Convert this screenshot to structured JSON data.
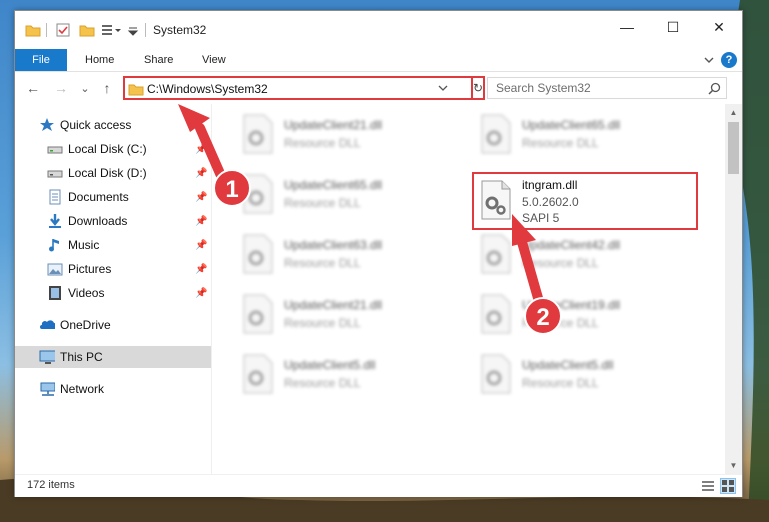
{
  "window": {
    "title": "System32",
    "controls": {
      "minimize": "—",
      "maximize": "☐",
      "close": "✕"
    }
  },
  "ribbon": {
    "tabs": [
      "File",
      "Home",
      "Share",
      "View"
    ],
    "help": "?"
  },
  "navigation": {
    "back": "←",
    "forward": "→",
    "recent": "⌄",
    "up": "↑",
    "address": "C:\\Windows\\System32",
    "refresh": "↻",
    "search_placeholder": "Search System32"
  },
  "sidebar": {
    "items": [
      {
        "label": "Quick access",
        "icon": "star-icon",
        "pinned": false
      },
      {
        "label": "Local Disk (C:)",
        "icon": "drive-icon",
        "pinned": true
      },
      {
        "label": "Local Disk (D:)",
        "icon": "drive-icon",
        "pinned": true
      },
      {
        "label": "Documents",
        "icon": "documents-icon",
        "pinned": true
      },
      {
        "label": "Downloads",
        "icon": "downloads-icon",
        "pinned": true
      },
      {
        "label": "Music",
        "icon": "music-icon",
        "pinned": true
      },
      {
        "label": "Pictures",
        "icon": "pictures-icon",
        "pinned": true
      },
      {
        "label": "Videos",
        "icon": "videos-icon",
        "pinned": true
      },
      {
        "label": "OneDrive",
        "icon": "onedrive-icon",
        "pinned": false
      },
      {
        "label": "This PC",
        "icon": "computer-icon",
        "pinned": false,
        "selected": true
      },
      {
        "label": "Network",
        "icon": "network-icon",
        "pinned": false
      }
    ]
  },
  "files": [
    {
      "name": "UpdateClient21.dll",
      "type": "Resource DLL",
      "blurred": true
    },
    {
      "name": "UpdateClient65.dll",
      "type": "Resource DLL",
      "blurred": true
    },
    {
      "name": "UpdateClient65.dll",
      "type": "Resource DLL",
      "blurred": true
    },
    {
      "name": "itngram.dll",
      "version": "5.0.2602.0",
      "type": "SAPI 5",
      "blurred": false,
      "highlighted": true
    },
    {
      "name": "UpdateClient63.dll",
      "type": "Resource DLL",
      "blurred": true
    },
    {
      "name": "UpdateClient42.dll",
      "type": "Resource DLL",
      "blurred": true
    },
    {
      "name": "UpdateClient21.dll",
      "type": "Resource DLL",
      "blurred": true
    },
    {
      "name": "UpdateClient19.dll",
      "type": "Resource DLL",
      "blurred": true
    },
    {
      "name": "UpdateClient5.dll",
      "type": "Resource DLL",
      "blurred": true
    },
    {
      "name": "UpdateClient5.dll",
      "type": "Resource DLL",
      "blurred": true
    }
  ],
  "status": {
    "item_count": "172 items"
  },
  "annotations": {
    "step1": "1",
    "step2": "2",
    "color": "#e0393e"
  }
}
